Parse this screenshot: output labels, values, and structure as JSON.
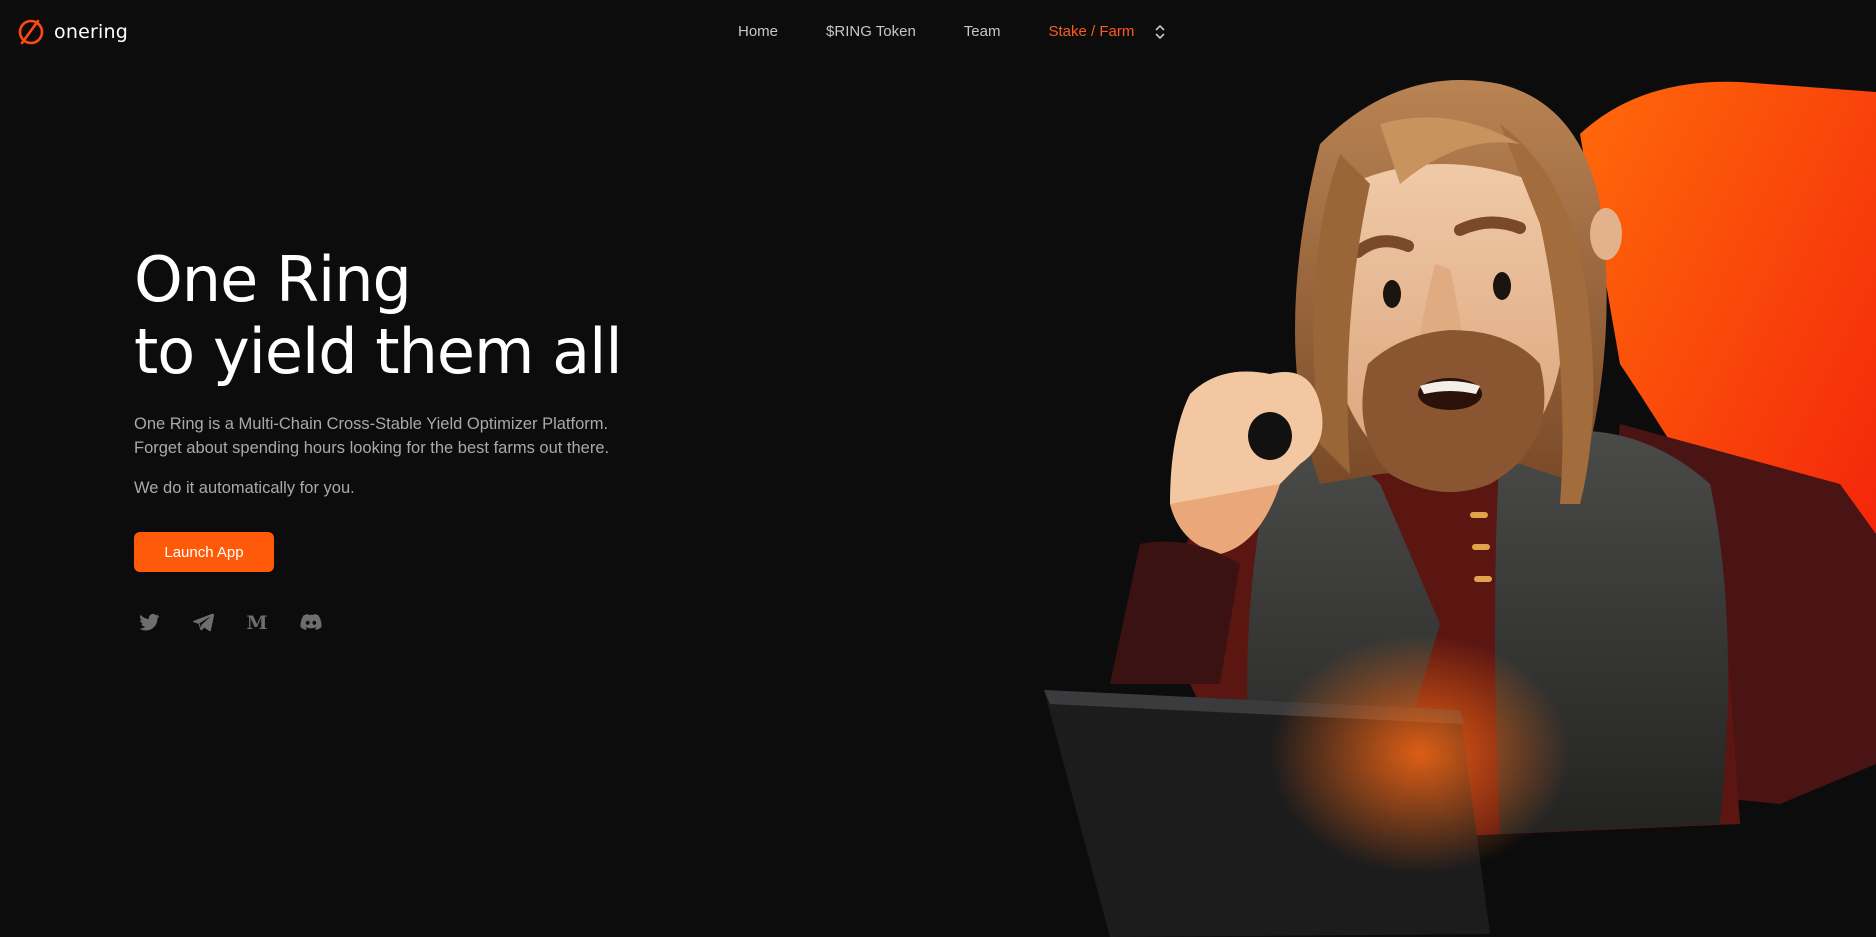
{
  "brand": {
    "name": "onering",
    "accent": "#ff5a0a"
  },
  "nav": {
    "items": [
      {
        "label": "Home"
      },
      {
        "label": "$RING Token"
      },
      {
        "label": "Team"
      },
      {
        "label": "Stake / Farm",
        "active": true
      }
    ]
  },
  "hero": {
    "title_line1": "One Ring",
    "title_line2": "to yield them all",
    "desc_line1": "One Ring is a Multi-Chain Cross-Stable Yield Optimizer Platform.",
    "desc_line2": "Forget about spending hours looking for the best farms out there.",
    "note": "We do it automatically for you.",
    "cta_label": "Launch App"
  },
  "socials": [
    {
      "icon": "twitter-icon"
    },
    {
      "icon": "telegram-icon"
    },
    {
      "icon": "medium-icon"
    },
    {
      "icon": "discord-icon"
    }
  ],
  "colors": {
    "background": "#0c0c0d",
    "text_muted": "#a9a9a9",
    "nav_text": "#c7c7c7",
    "nav_active": "#ff5a1f"
  }
}
